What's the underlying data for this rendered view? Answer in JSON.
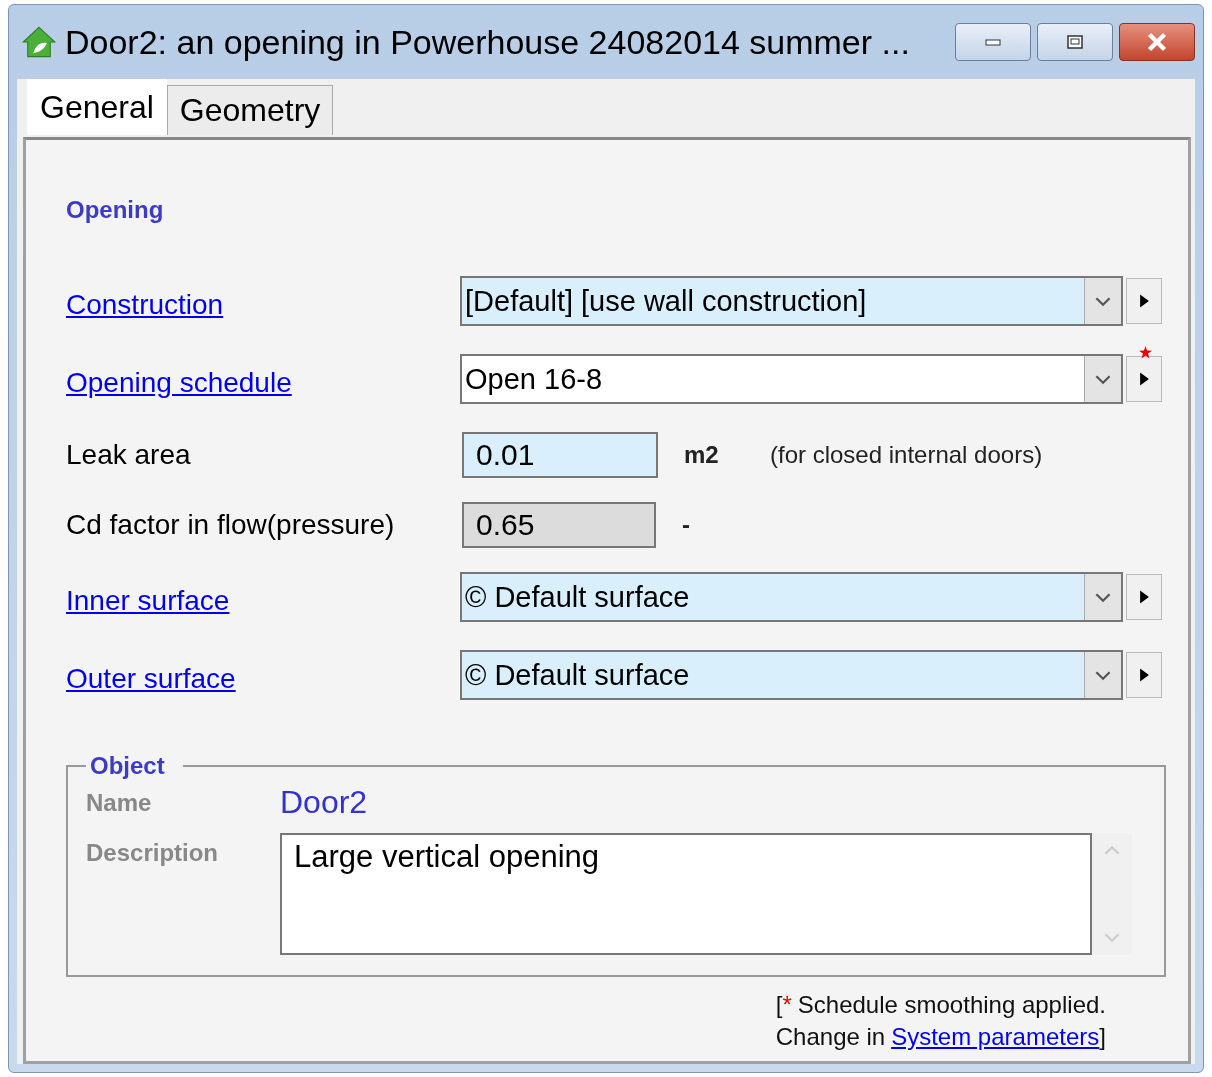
{
  "window": {
    "title": "Door2: an opening in Powerhouse 24082014 summer ..."
  },
  "tabs": [
    {
      "label": "General",
      "selected": true
    },
    {
      "label": "Geometry",
      "selected": false
    }
  ],
  "section": "Opening",
  "rows": [
    {
      "kind": "dropdown",
      "label": "Construction",
      "value": "[Default] [use wall construction]",
      "highlighted": true,
      "starred": false
    },
    {
      "kind": "dropdown",
      "label": "Opening schedule",
      "value": "Open 16-8",
      "highlighted": false,
      "starred": true
    },
    {
      "kind": "field",
      "label": "Leak area",
      "value": "0.01",
      "disabled": false,
      "unit": "m2",
      "note": "(for closed internal doors)"
    },
    {
      "kind": "field",
      "label": "Cd factor in flow(pressure)",
      "value": "0.65",
      "disabled": true,
      "unit": "-"
    },
    {
      "kind": "dropdown",
      "label": "Inner surface",
      "value": "© Default surface",
      "highlighted": true,
      "starred": false
    },
    {
      "kind": "dropdown",
      "label": "Outer surface",
      "value": "© Default surface",
      "highlighted": true,
      "starred": false
    }
  ],
  "object": {
    "title": "Object",
    "name_label": "Name",
    "name": "Door2",
    "description_label": "Description",
    "description": "Large vertical opening"
  },
  "footer": {
    "open": "[",
    "star": "*",
    "line1": "Schedule smoothing applied.",
    "line2": "Change in",
    "link": "System parameters",
    "close": "]"
  }
}
